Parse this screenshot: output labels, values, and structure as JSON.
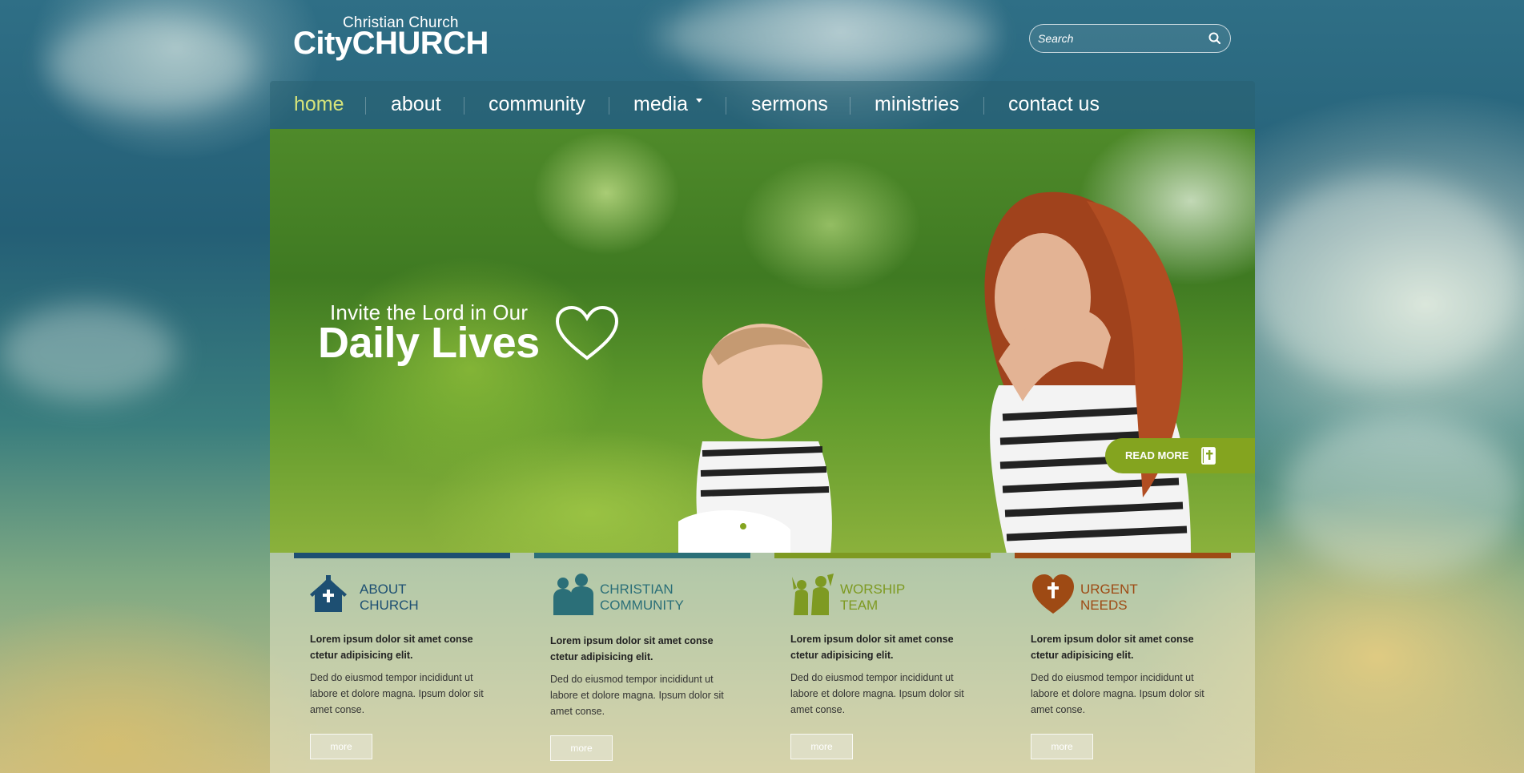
{
  "header": {
    "logo_subtitle": "Christian Church",
    "logo_title": "CityCHURCH",
    "search_placeholder": "Search"
  },
  "nav": {
    "items": [
      {
        "label": "home",
        "active": true
      },
      {
        "label": "about"
      },
      {
        "label": "community"
      },
      {
        "label": "media",
        "has_dropdown": true
      },
      {
        "label": "sermons"
      },
      {
        "label": "ministries"
      },
      {
        "label": "contact us"
      }
    ]
  },
  "slider": {
    "line1": "Invite the Lord in Our",
    "line2": "Daily Lives",
    "read_more": "READ MORE",
    "slide_count": 3,
    "active_slide": 1
  },
  "features": [
    {
      "title_line1": "ABOUT",
      "title_line2": "CHURCH",
      "icon": "church-icon",
      "color": "#1d4f72",
      "bold_text": "Lorem ipsum dolor sit amet conse ctetur adipisicing elit.",
      "text": "Ded do eiusmod tempor incididunt ut labore et dolore magna. Ipsum dolor sit amet conse.",
      "button": "more"
    },
    {
      "title_line1": "CHRISTIAN",
      "title_line2": "COMMUNITY",
      "icon": "community-icon",
      "color": "#2b6f78",
      "bold_text": "Lorem ipsum dolor sit amet conse ctetur adipisicing elit.",
      "text": "Ded do eiusmod tempor incididunt ut labore et dolore magna. Ipsum dolor sit amet conse.",
      "button": "more"
    },
    {
      "title_line1": "WORSHIP",
      "title_line2": "TEAM",
      "icon": "worship-icon",
      "color": "#7e9a22",
      "bold_text": "Lorem ipsum dolor sit amet conse ctetur adipisicing elit.",
      "text": "Ded do eiusmod tempor incididunt ut labore et dolore magna. Ipsum dolor sit amet conse.",
      "button": "more"
    },
    {
      "title_line1": "URGENT",
      "title_line2": "NEEDS",
      "icon": "heart-cross-icon",
      "color": "#9e4a14",
      "bold_text": "Lorem ipsum dolor sit amet conse ctetur adipisicing elit.",
      "text": "Ded do eiusmod tempor incididunt ut labore et dolore magna. Ipsum dolor sit amet conse.",
      "button": "more"
    }
  ]
}
